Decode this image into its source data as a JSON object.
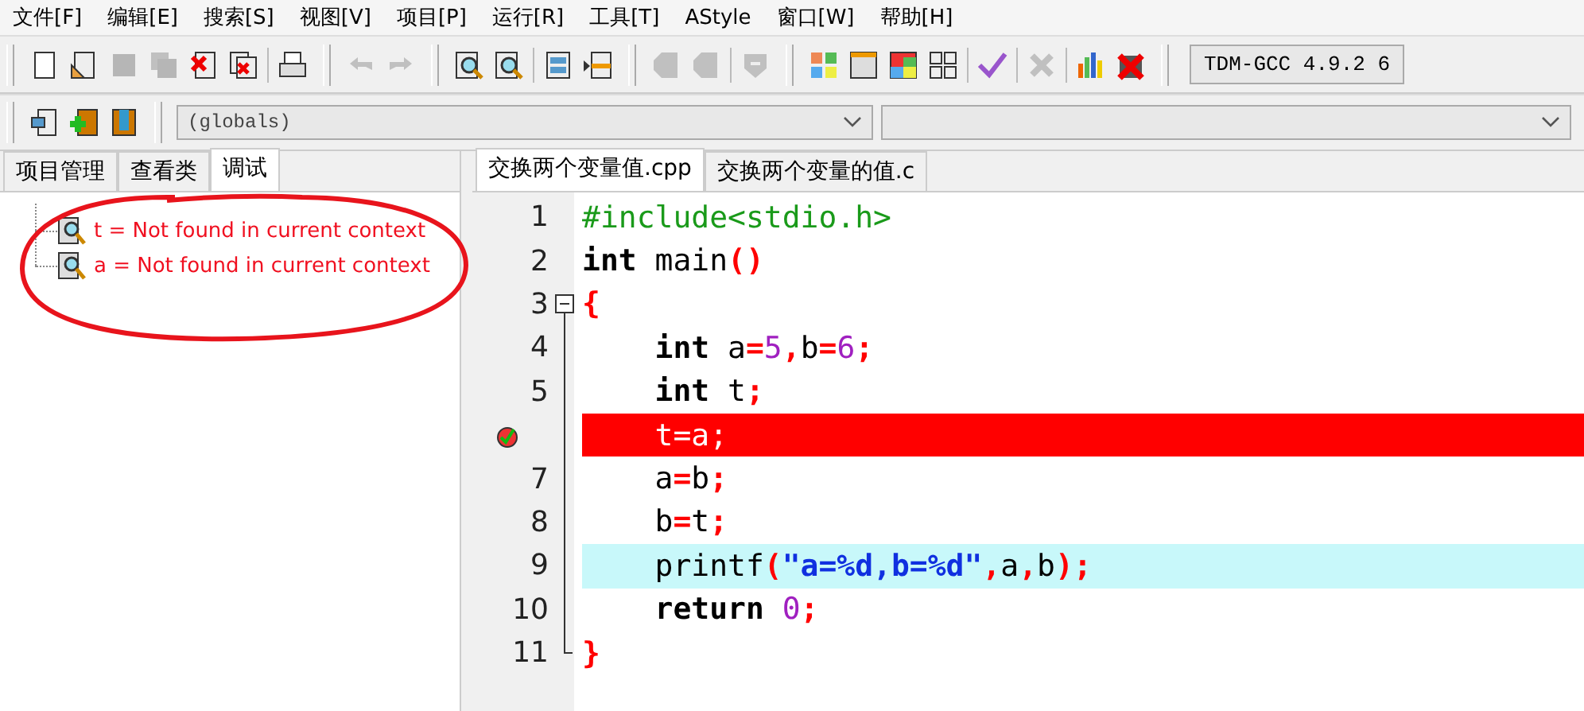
{
  "menu": [
    "文件[F]",
    "编辑[E]",
    "搜索[S]",
    "视图[V]",
    "项目[P]",
    "运行[R]",
    "工具[T]",
    "AStyle",
    "窗口[W]",
    "帮助[H]"
  ],
  "toolbar": [
    {
      "kind": "page",
      "disabled": false
    },
    {
      "kind": "open",
      "disabled": false
    },
    {
      "kind": "save",
      "disabled": true
    },
    {
      "kind": "saveall",
      "disabled": true
    },
    {
      "kind": "close",
      "disabled": false
    },
    {
      "kind": "closeall",
      "disabled": false
    },
    {
      "kind": "sep"
    },
    {
      "kind": "print",
      "disabled": false
    },
    {
      "kind": "group"
    },
    {
      "kind": "undo",
      "disabled": true
    },
    {
      "kind": "redo",
      "disabled": true
    },
    {
      "kind": "group"
    },
    {
      "kind": "find",
      "disabled": false
    },
    {
      "kind": "find",
      "disabled": false
    },
    {
      "kind": "sep"
    },
    {
      "kind": "panes",
      "disabled": false
    },
    {
      "kind": "split",
      "disabled": false
    },
    {
      "kind": "group"
    },
    {
      "kind": "tag",
      "disabled": true
    },
    {
      "kind": "tag",
      "disabled": true
    },
    {
      "kind": "sep"
    },
    {
      "kind": "shield",
      "disabled": true
    },
    {
      "kind": "group"
    },
    {
      "kind": "tiles",
      "disabled": false
    },
    {
      "kind": "window",
      "disabled": false
    },
    {
      "kind": "colorwin",
      "disabled": false
    },
    {
      "kind": "grid",
      "disabled": false
    },
    {
      "kind": "sep"
    },
    {
      "kind": "check",
      "disabled": false
    },
    {
      "kind": "sep"
    },
    {
      "kind": "cross",
      "disabled": true
    },
    {
      "kind": "sep"
    },
    {
      "kind": "chart",
      "disabled": false
    },
    {
      "kind": "stop",
      "disabled": false
    },
    {
      "kind": "group"
    }
  ],
  "compiler": "TDM-GCC 4.9.2 6",
  "toolbar2": [
    {
      "kind": "frame",
      "disabled": false
    },
    {
      "kind": "add",
      "disabled": false
    },
    {
      "kind": "book",
      "disabled": false
    }
  ],
  "scope_select": {
    "value": "(globals)"
  },
  "left_tabs": [
    {
      "label": "项目管理",
      "selected": false
    },
    {
      "label": "查看类",
      "selected": false
    },
    {
      "label": "调试",
      "selected": true
    }
  ],
  "watches": [
    "t = Not found in current context",
    "a = Not found in current context"
  ],
  "editor_tabs": [
    {
      "label": "交换两个变量值.cpp",
      "selected": true
    },
    {
      "label": "交换两个变量的值.c",
      "selected": false
    }
  ],
  "code": [
    {
      "number": "1",
      "in_block": false,
      "breakpoint": false,
      "current": false,
      "tokens": [
        {
          "text": "#include<stdio.h>",
          "kind": "pre"
        }
      ]
    },
    {
      "number": "2",
      "in_block": false,
      "breakpoint": false,
      "current": false,
      "tokens": [
        {
          "text": "int",
          "kind": "kw"
        },
        {
          "text": " main",
          "kind": "id"
        },
        {
          "text": "()",
          "kind": "op"
        }
      ]
    },
    {
      "number": "3",
      "in_block": true,
      "breakpoint": false,
      "current": false,
      "tokens": [
        {
          "text": "{",
          "kind": "op"
        }
      ]
    },
    {
      "number": "4",
      "in_block": true,
      "breakpoint": false,
      "current": false,
      "tokens": [
        {
          "text": "    int",
          "kind": "kw"
        },
        {
          "text": " a",
          "kind": "id"
        },
        {
          "text": "=",
          "kind": "op"
        },
        {
          "text": "5",
          "kind": "num"
        },
        {
          "text": ",",
          "kind": "op"
        },
        {
          "text": "b",
          "kind": "id"
        },
        {
          "text": "=",
          "kind": "op"
        },
        {
          "text": "6",
          "kind": "num"
        },
        {
          "text": ";",
          "kind": "op"
        }
      ]
    },
    {
      "number": "5",
      "in_block": true,
      "breakpoint": false,
      "current": false,
      "tokens": [
        {
          "text": "    int",
          "kind": "kw"
        },
        {
          "text": " t",
          "kind": "id"
        },
        {
          "text": ";",
          "kind": "op"
        }
      ]
    },
    {
      "in_block": true,
      "breakpoint": true,
      "current": false,
      "tokens": [
        {
          "text": "    t=a;",
          "kind": "id"
        }
      ]
    },
    {
      "number": "7",
      "in_block": true,
      "breakpoint": false,
      "current": false,
      "tokens": [
        {
          "text": "    a",
          "kind": "id"
        },
        {
          "text": "=",
          "kind": "op"
        },
        {
          "text": "b",
          "kind": "id"
        },
        {
          "text": ";",
          "kind": "op"
        }
      ]
    },
    {
      "number": "8",
      "in_block": true,
      "breakpoint": false,
      "current": false,
      "tokens": [
        {
          "text": "    b",
          "kind": "id"
        },
        {
          "text": "=",
          "kind": "op"
        },
        {
          "text": "t",
          "kind": "id"
        },
        {
          "text": ";",
          "kind": "op"
        }
      ]
    },
    {
      "number": "9",
      "in_block": true,
      "breakpoint": false,
      "current": true,
      "tokens": [
        {
          "text": "    printf",
          "kind": "id"
        },
        {
          "text": "(",
          "kind": "op"
        },
        {
          "text": "\"a=%d,b=%d\"",
          "kind": "str"
        },
        {
          "text": ",",
          "kind": "op"
        },
        {
          "text": "a",
          "kind": "id"
        },
        {
          "text": ",",
          "kind": "op"
        },
        {
          "text": "b",
          "kind": "id"
        },
        {
          "text": ");",
          "kind": "op"
        }
      ]
    },
    {
      "number": "10",
      "in_block": true,
      "breakpoint": false,
      "current": false,
      "tokens": [
        {
          "text": "    return",
          "kind": "kw"
        },
        {
          "text": " 0",
          "kind": "num"
        },
        {
          "text": ";",
          "kind": "op"
        }
      ]
    },
    {
      "number": "11",
      "in_block": true,
      "breakpoint": false,
      "current": false,
      "tokens": [
        {
          "text": "}",
          "kind": "op"
        }
      ]
    }
  ]
}
